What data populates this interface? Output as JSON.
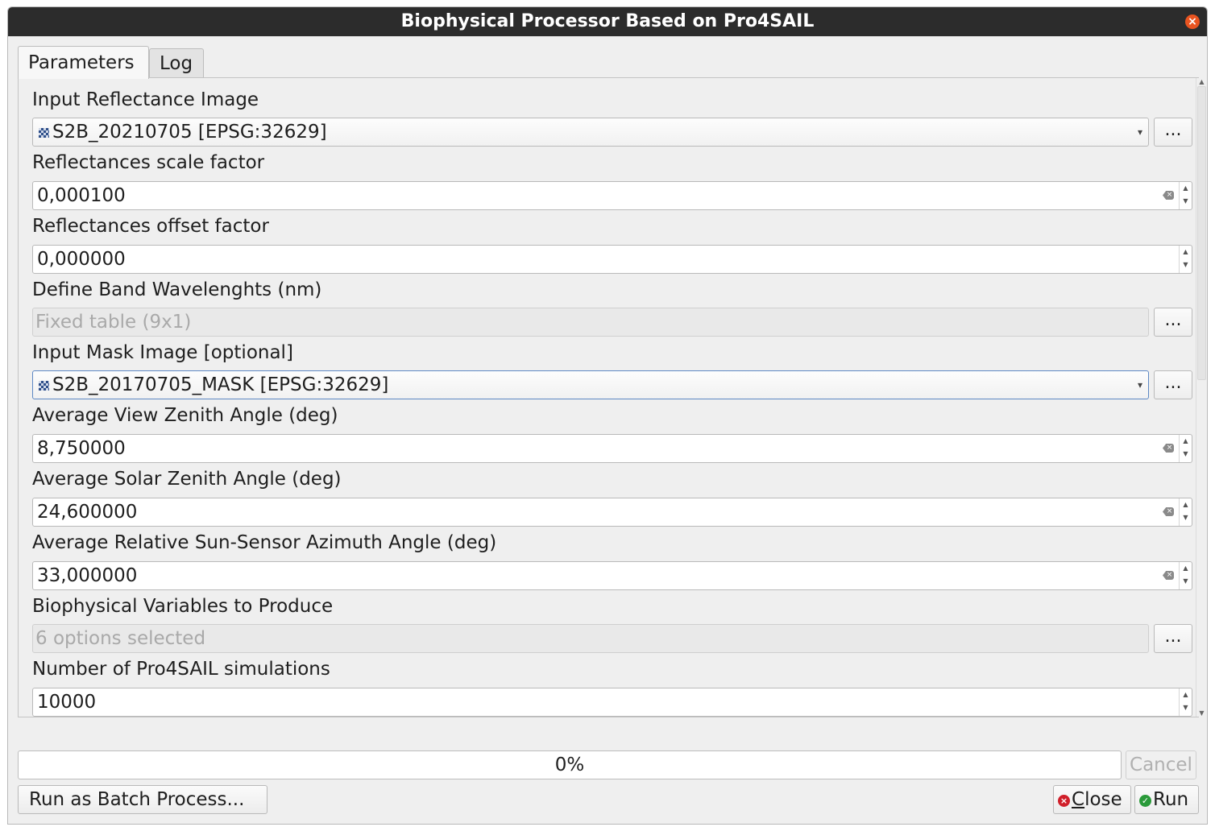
{
  "window": {
    "title": "Biophysical Processor Based on Pro4SAIL",
    "close_icon": "close-icon"
  },
  "tabs": [
    {
      "label": "Parameters",
      "active": true
    },
    {
      "label": "Log",
      "active": false
    }
  ],
  "params": {
    "input_reflectance": {
      "label": "Input Reflectance Image",
      "value": "S2B_20210705 [EPSG:32629]",
      "browse": "..."
    },
    "scale_factor": {
      "label": "Reflectances scale factor",
      "value": "0,000100"
    },
    "offset_factor": {
      "label": "Reflectances offset factor",
      "value": "0,000000"
    },
    "band_wavelengths": {
      "label": "Define Band Wavelenghts (nm)",
      "value": "Fixed table (9x1)",
      "browse": "..."
    },
    "mask_image": {
      "label": "Input Mask Image [optional]",
      "value": "S2B_20170705_MASK [EPSG:32629]",
      "browse": "..."
    },
    "view_zenith": {
      "label": "Average View Zenith Angle (deg)",
      "value": "8,750000"
    },
    "solar_zenith": {
      "label": "Average Solar Zenith Angle (deg)",
      "value": "24,600000"
    },
    "relative_azimuth": {
      "label": "Average Relative Sun-Sensor Azimuth Angle (deg)",
      "value": "33,000000"
    },
    "variables": {
      "label": "Biophysical Variables to Produce",
      "value": "6 options selected",
      "browse": "..."
    },
    "simulations": {
      "label": "Number of Pro4SAIL simulations",
      "value": "10000"
    }
  },
  "progress": {
    "text": "0%",
    "fraction": 0
  },
  "buttons": {
    "cancel": "Cancel",
    "batch": "Run as Batch Process...",
    "close_underlined": "C",
    "close_rest": "lose",
    "run": "Run"
  },
  "colors": {
    "titlebar": "#2c2c2c",
    "window_close": "#e95420",
    "close_icon": "#d01f2a",
    "run_icon": "#2a9a3a"
  }
}
